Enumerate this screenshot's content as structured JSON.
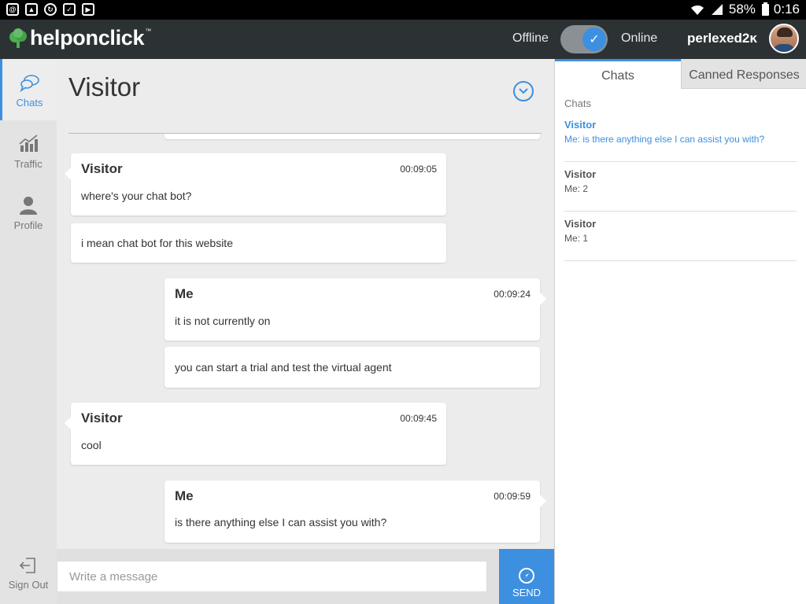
{
  "statusbar": {
    "battery": "58%",
    "time": "0:16"
  },
  "header": {
    "logo_text": "helponclick",
    "logo_tm": "™",
    "status_offline": "Offline",
    "status_online": "Online",
    "username": "perlexed2ĸ"
  },
  "nav": {
    "chats": "Chats",
    "traffic": "Traffic",
    "profile": "Profile",
    "signout": "Sign Out"
  },
  "chat": {
    "title": "Visitor",
    "messages": [
      {
        "author": "Visitor",
        "time": "00:09:05",
        "text": "where's your chat bot?"
      },
      {
        "text": "i mean chat bot for this website"
      },
      {
        "author": "Me",
        "time": "00:09:24",
        "text": "it is not currently on"
      },
      {
        "text": "you can start a trial and test the virtual agent"
      },
      {
        "author": "Visitor",
        "time": "00:09:45",
        "text": "cool"
      },
      {
        "author": "Me",
        "time": "00:09:59",
        "text": "is there anything else I can assist you with?"
      }
    ]
  },
  "composer": {
    "placeholder": "Write a message",
    "send_label": "SEND"
  },
  "rightpanel": {
    "tabs": [
      "Chats",
      "Canned Responses"
    ],
    "section_label": "Chats",
    "conversations": [
      {
        "name": "Visitor",
        "last": "Me: is there anything else I can assist you with?"
      },
      {
        "name": "Visitor",
        "last": "Me: 2"
      },
      {
        "name": "Visitor",
        "last": "Me: 1"
      }
    ]
  },
  "colors": {
    "accent": "#3d8fe0",
    "header_bg": "#2c3134"
  }
}
